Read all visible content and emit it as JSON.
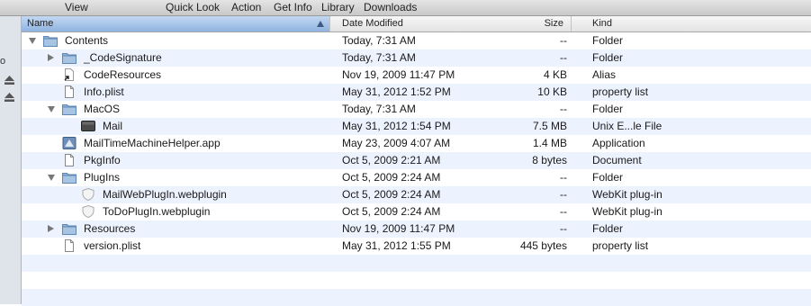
{
  "toolbar": {
    "items": [
      "View",
      "Quick Look",
      "Action",
      "Get Info",
      "Library",
      "Downloads"
    ]
  },
  "sidebar": {
    "partial_text": "o"
  },
  "columns": {
    "name": "Name",
    "date": "Date Modified",
    "size": "Size",
    "kind": "Kind"
  },
  "sort": {
    "column": "Name",
    "direction": "ascending"
  },
  "rows": [
    {
      "name": "Contents",
      "date": "Today, 7:31 AM",
      "size": "--",
      "kind": "Folder",
      "indent": 0,
      "icon": "folder-icon",
      "disclosure": "open"
    },
    {
      "name": "_CodeSignature",
      "date": "Today, 7:31 AM",
      "size": "--",
      "kind": "Folder",
      "indent": 1,
      "icon": "folder-icon",
      "disclosure": "closed"
    },
    {
      "name": "CodeResources",
      "date": "Nov 19, 2009 11:47 PM",
      "size": "4 KB",
      "kind": "Alias",
      "indent": 1,
      "icon": "alias-icon",
      "disclosure": "none"
    },
    {
      "name": "Info.plist",
      "date": "May 31, 2012 1:52 PM",
      "size": "10 KB",
      "kind": "property list",
      "indent": 1,
      "icon": "document-icon",
      "disclosure": "none"
    },
    {
      "name": "MacOS",
      "date": "Today, 7:31 AM",
      "size": "--",
      "kind": "Folder",
      "indent": 1,
      "icon": "folder-icon",
      "disclosure": "open"
    },
    {
      "name": "Mail",
      "date": "May 31, 2012 1:54 PM",
      "size": "7.5 MB",
      "kind": "Unix E...le File",
      "indent": 2,
      "icon": "executable-icon",
      "disclosure": "none"
    },
    {
      "name": "MailTimeMachineHelper.app",
      "date": "May 23, 2009 4:07 AM",
      "size": "1.4 MB",
      "kind": "Application",
      "indent": 1,
      "icon": "application-icon",
      "disclosure": "none"
    },
    {
      "name": "PkgInfo",
      "date": "Oct 5, 2009 2:21 AM",
      "size": "8 bytes",
      "kind": "Document",
      "indent": 1,
      "icon": "document-icon",
      "disclosure": "none"
    },
    {
      "name": "PlugIns",
      "date": "Oct 5, 2009 2:24 AM",
      "size": "--",
      "kind": "Folder",
      "indent": 1,
      "icon": "folder-icon",
      "disclosure": "open"
    },
    {
      "name": "MailWebPlugIn.webplugin",
      "date": "Oct 5, 2009 2:24 AM",
      "size": "--",
      "kind": "WebKit plug-in",
      "indent": 2,
      "icon": "plugin-icon",
      "disclosure": "none"
    },
    {
      "name": "ToDoPlugIn.webplugin",
      "date": "Oct 5, 2009 2:24 AM",
      "size": "--",
      "kind": "WebKit plug-in",
      "indent": 2,
      "icon": "plugin-icon",
      "disclosure": "none"
    },
    {
      "name": "Resources",
      "date": "Nov 19, 2009 11:47 PM",
      "size": "--",
      "kind": "Folder",
      "indent": 1,
      "icon": "folder-icon",
      "disclosure": "closed"
    },
    {
      "name": "version.plist",
      "date": "May 31, 2012 1:55 PM",
      "size": "445 bytes",
      "kind": "property list",
      "indent": 1,
      "icon": "document-icon",
      "disclosure": "none"
    }
  ],
  "colors": {
    "stripe": "#edf3fe",
    "folder": "#8fb2d6",
    "header_selected": "#9fbfe6"
  }
}
